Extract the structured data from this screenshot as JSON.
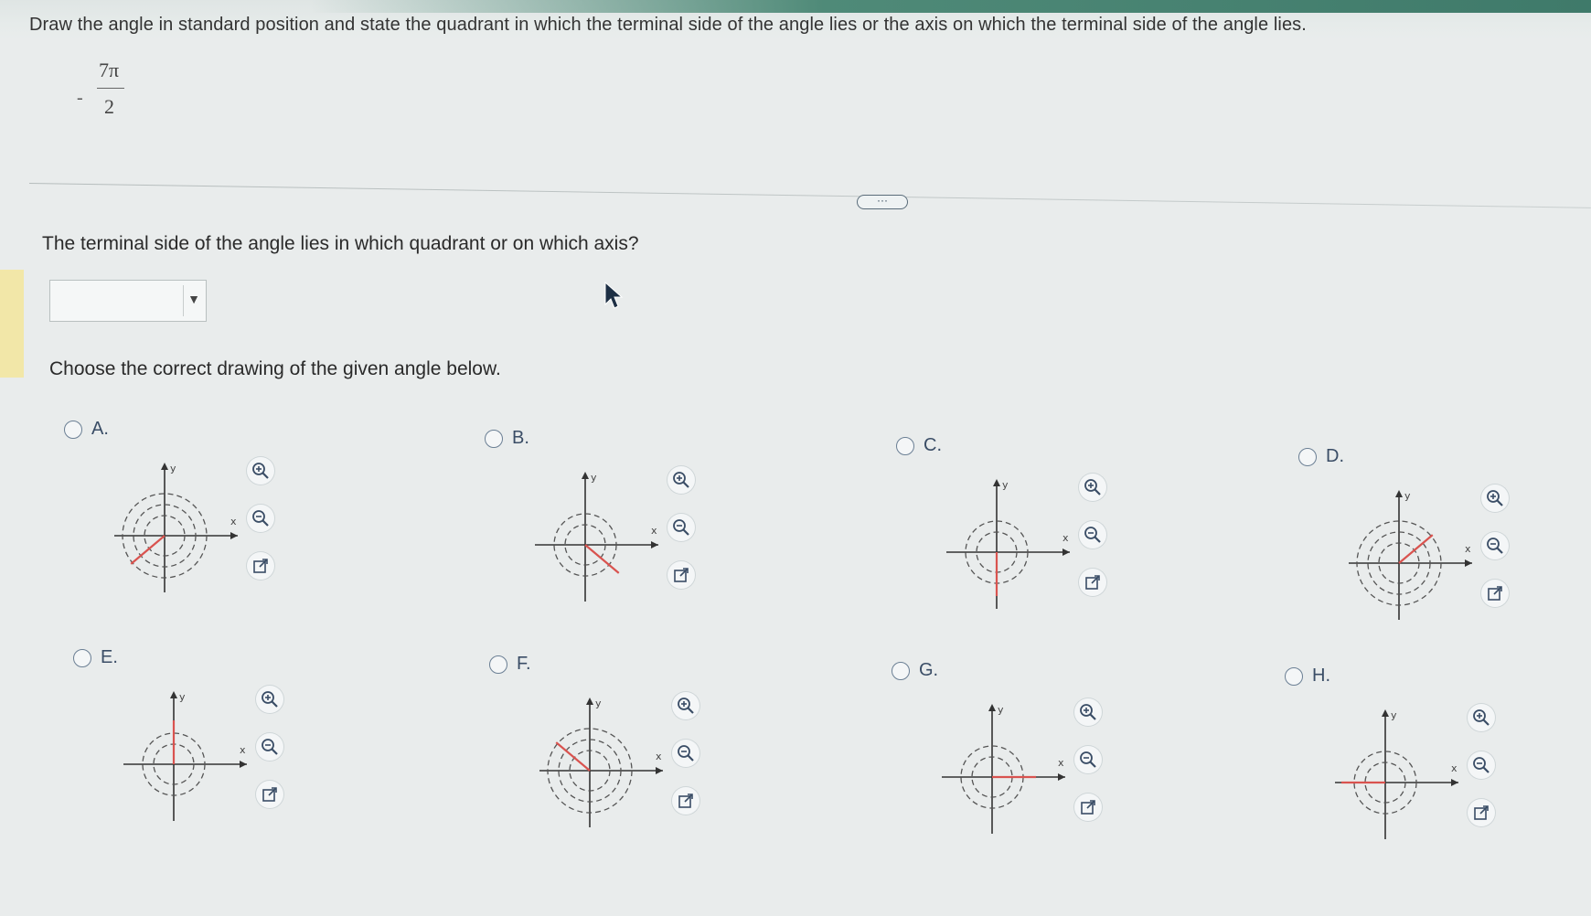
{
  "question": {
    "text": "Draw the angle in standard position and state the quadrant in which the terminal side of the angle lies or the axis on which the terminal side of the angle lies.",
    "angle": {
      "sign": "-",
      "numerator": "7π",
      "denominator": "2"
    }
  },
  "more_button": "···",
  "part1": {
    "prompt": "The terminal side of the angle lies in which quadrant or on which axis?",
    "dropdown_value": "",
    "dropdown_arrow": "▼"
  },
  "part2": {
    "prompt": "Choose the correct drawing of the given angle below."
  },
  "axis_labels": {
    "x": "x",
    "y": "y"
  },
  "colors": {
    "terminal_side": "#d9534f",
    "axes": "#333333",
    "spiral": "#555555",
    "link": "#3a4d66"
  },
  "options": [
    {
      "letter": "A.",
      "terminal": "quadrant-3",
      "turns": 3
    },
    {
      "letter": "B.",
      "terminal": "quadrant-4",
      "turns": 2
    },
    {
      "letter": "C.",
      "terminal": "negative-y-axis",
      "turns": 2
    },
    {
      "letter": "D.",
      "terminal": "quadrant-1",
      "turns": 3
    },
    {
      "letter": "E.",
      "terminal": "positive-y-axis",
      "turns": 2
    },
    {
      "letter": "F.",
      "terminal": "quadrant-2",
      "turns": 3
    },
    {
      "letter": "G.",
      "terminal": "positive-x-axis",
      "turns": 2
    },
    {
      "letter": "H.",
      "terminal": "negative-x-axis",
      "turns": 2
    }
  ]
}
